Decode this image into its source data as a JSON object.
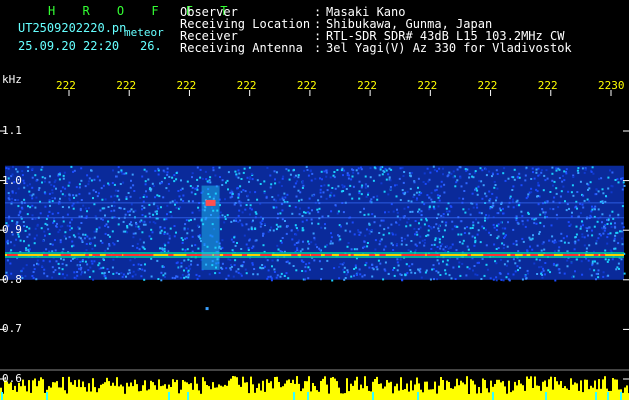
{
  "header": {
    "brand": "H R O F F T",
    "filename": "UT2509202220.pn",
    "type": "meteor",
    "datetime": "25.09.20 22:20",
    "field": "26.",
    "info": [
      {
        "label": "Observer",
        "value": "Masaki Kano"
      },
      {
        "label": "Receiving Location",
        "value": "Shibukawa, Gunma, Japan"
      },
      {
        "label": "Receiver",
        "value": "RTL-SDR SDR# 43dB L15 103.2MHz CW"
      },
      {
        "label": "Receiving Antenna",
        "value": "3el Yagi(V) Az 330 for Vladivostok"
      }
    ]
  },
  "chart_data": {
    "type": "heatmap",
    "ylabel": "kHz",
    "yticks": [
      "1.1",
      "1.0",
      "0.9",
      "0.8",
      "0.7",
      "0.6"
    ],
    "xticks": [
      "222",
      "222",
      "222",
      "222",
      "222",
      "222",
      "222",
      "222",
      "222",
      "2230"
    ],
    "ylim": [
      0.6,
      1.15
    ],
    "noise_band": [
      0.8,
      1.03
    ],
    "carrier_line_khz": 0.85,
    "faint_lines_khz": [
      0.925,
      0.955
    ],
    "meteor_echo": {
      "x_fraction": 0.33,
      "khz_range": [
        0.82,
        0.99
      ]
    },
    "colors": {
      "noise": "#0a2a9a",
      "carrier": "#ff3030",
      "bar": "#ffff00",
      "marker": "#33ffff"
    }
  }
}
